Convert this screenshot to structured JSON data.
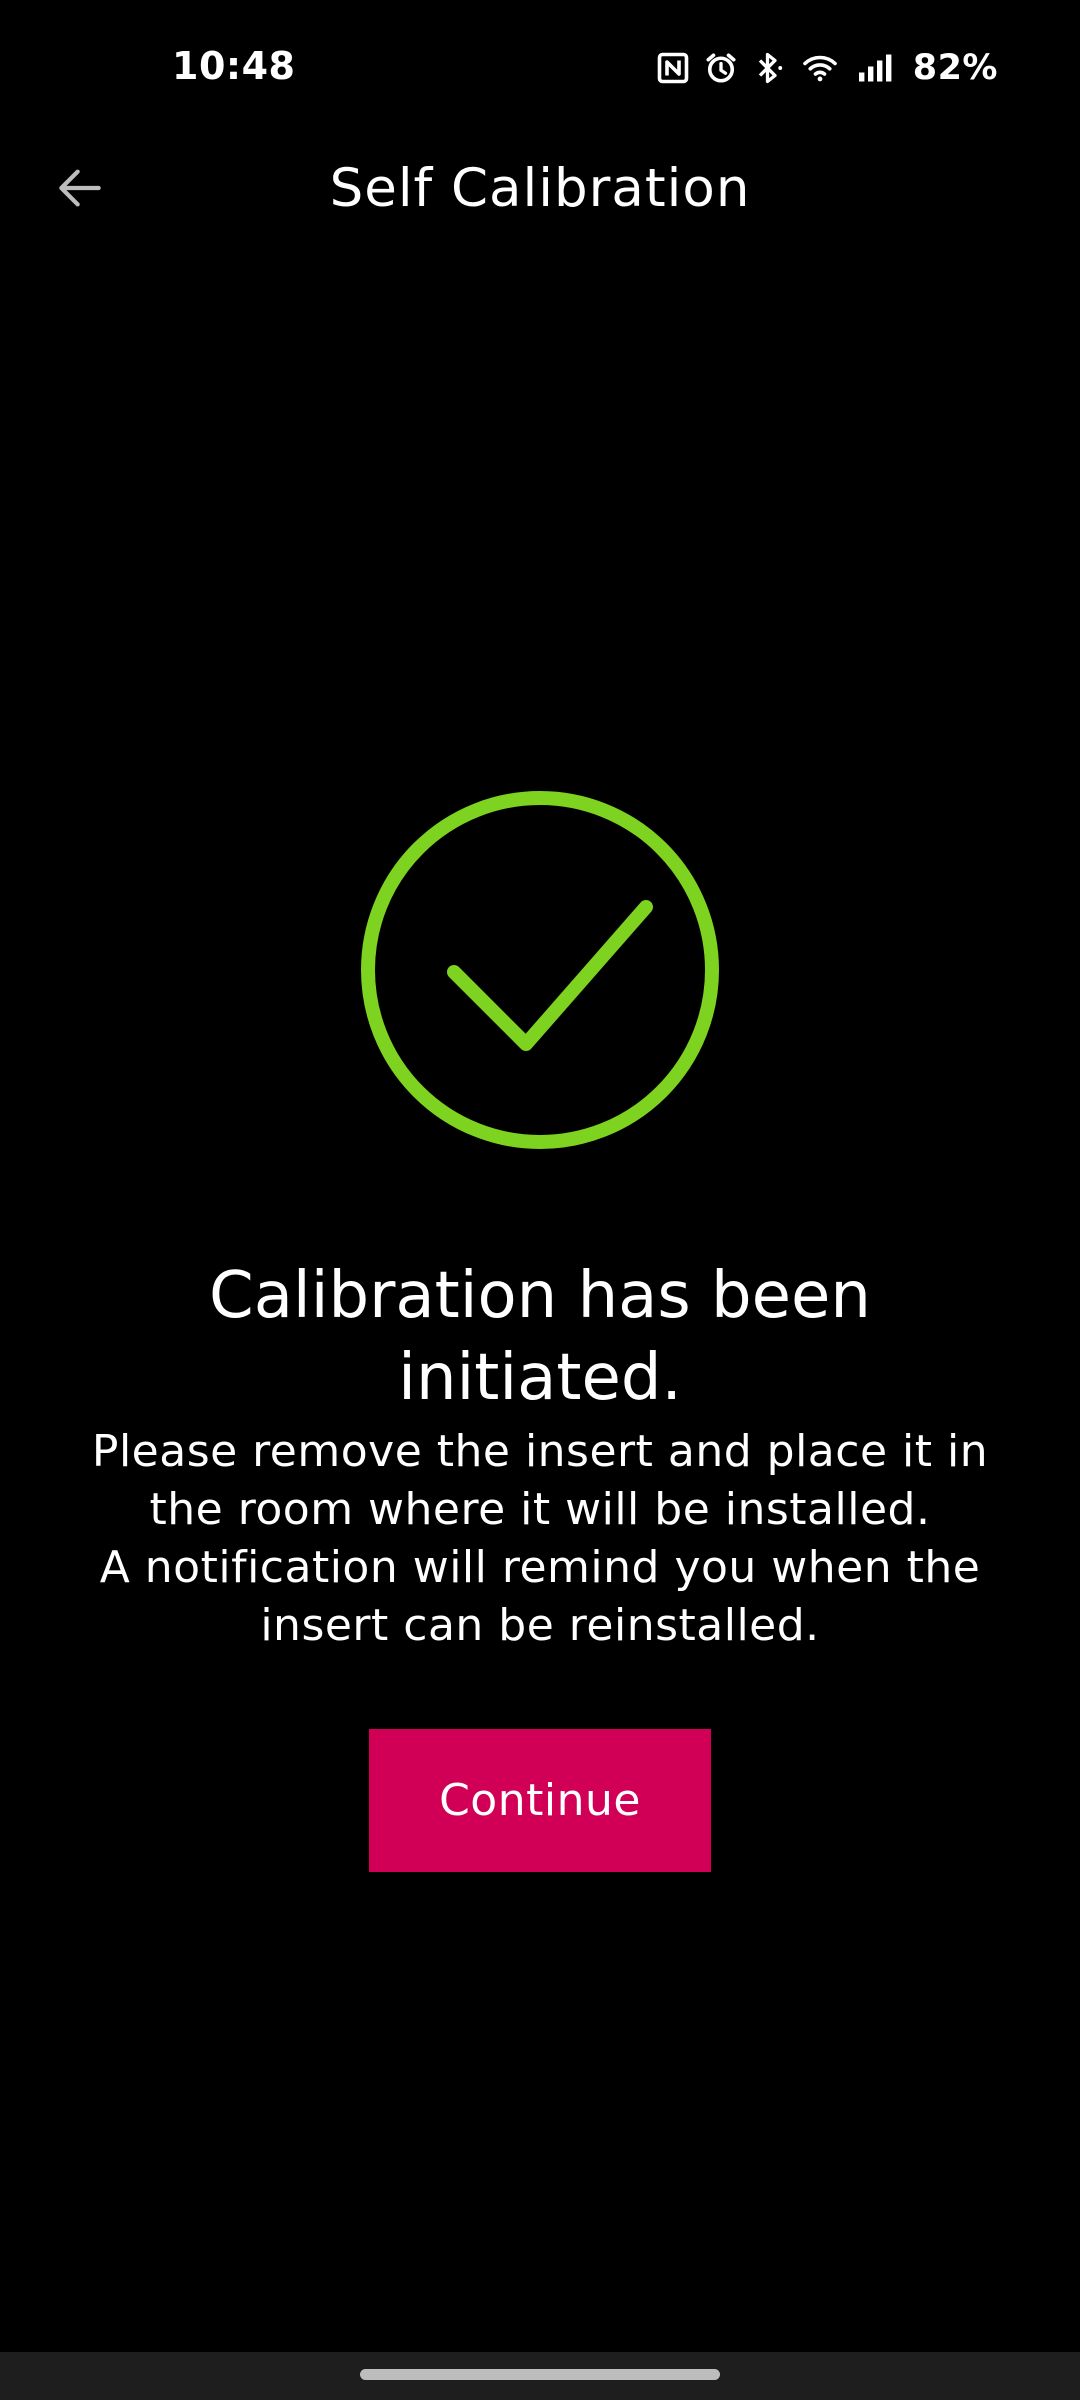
{
  "status_bar": {
    "time": "10:48",
    "battery": "82%",
    "icons": [
      "nfc-icon",
      "alarm-icon",
      "bluetooth-icon",
      "wifi-icon",
      "signal-icon"
    ]
  },
  "app_bar": {
    "title": "Self Calibration",
    "back_icon": "arrow-back-icon"
  },
  "content": {
    "status_icon": "check-circle-icon",
    "headline": "Calibration has been initiated.",
    "body_line1": "Please remove the insert and place it in the room where it will be installed.",
    "body_line2": "A notification will remind you when the insert can be reinstalled.",
    "continue_label": "Continue"
  },
  "colors": {
    "background": "#000000",
    "accent_green": "#7ed321",
    "button_magenta": "#d10056",
    "text": "#ffffff"
  }
}
